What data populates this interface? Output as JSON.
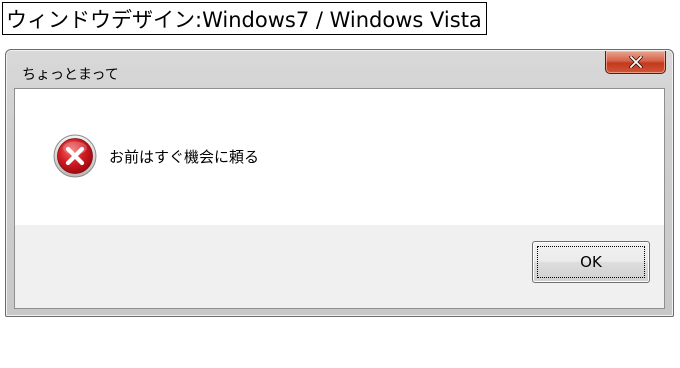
{
  "caption": {
    "text": "ウィンドウデザイン:Windows7 / Windows Vista"
  },
  "dialog": {
    "title": "ちょっとまって",
    "message": "お前はすぐ機会に頼る",
    "icon": "error-icon",
    "ok_label": "OK",
    "close_symbol": "x"
  },
  "colors": {
    "close_button": "#c7432a",
    "error_icon": "#c8161d",
    "content_background": "#ffffff",
    "footer_background": "#f0f0f0"
  }
}
